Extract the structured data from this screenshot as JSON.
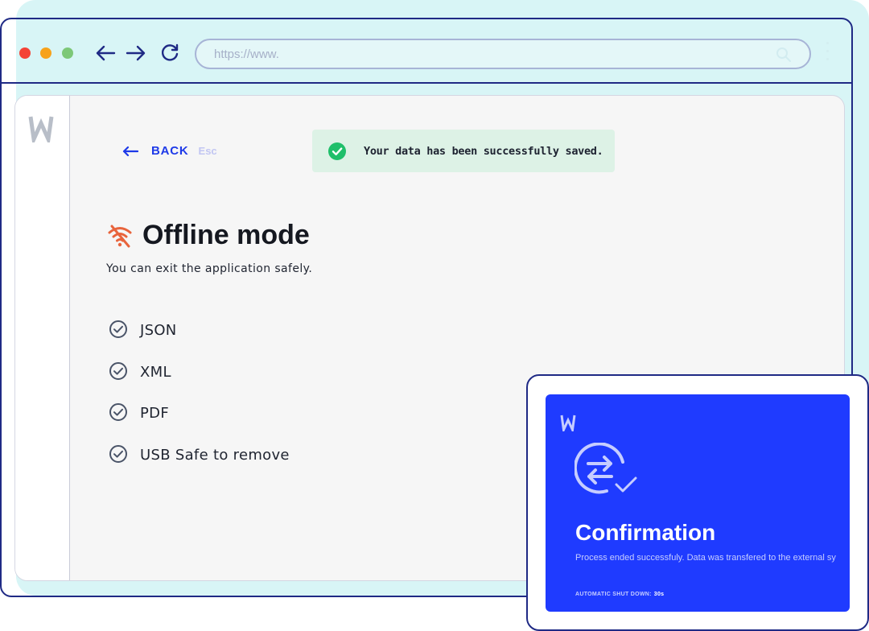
{
  "browser": {
    "url": "https://www.",
    "traffic_lights": [
      "#f44336",
      "#f7a21b",
      "#7dc878"
    ],
    "nav_icons": [
      "back-arrow-icon",
      "forward-arrow-icon",
      "reload-icon"
    ]
  },
  "app": {
    "back": {
      "label": "BACK",
      "shortcut": "Esc"
    },
    "toast": {
      "message": "Your data has been successfully saved.",
      "status_color": "#1fbf6a"
    },
    "page": {
      "title": "Offline mode",
      "subtitle": "You can exit the application safely.",
      "status_icon": "wifi-off-icon",
      "accent_color": "#e8643c"
    },
    "checklist": [
      {
        "label": "JSON"
      },
      {
        "label": "XML"
      },
      {
        "label": "PDF"
      },
      {
        "label": "USB Safe to remove"
      }
    ]
  },
  "modal": {
    "title": "Confirmation",
    "description": "Process ended successfuly. Data was transfered to the external sy",
    "shutdown_label": "AUTOMATIC SHUT DOWN:",
    "shutdown_time": "30s",
    "background_color": "#1f3bff"
  }
}
